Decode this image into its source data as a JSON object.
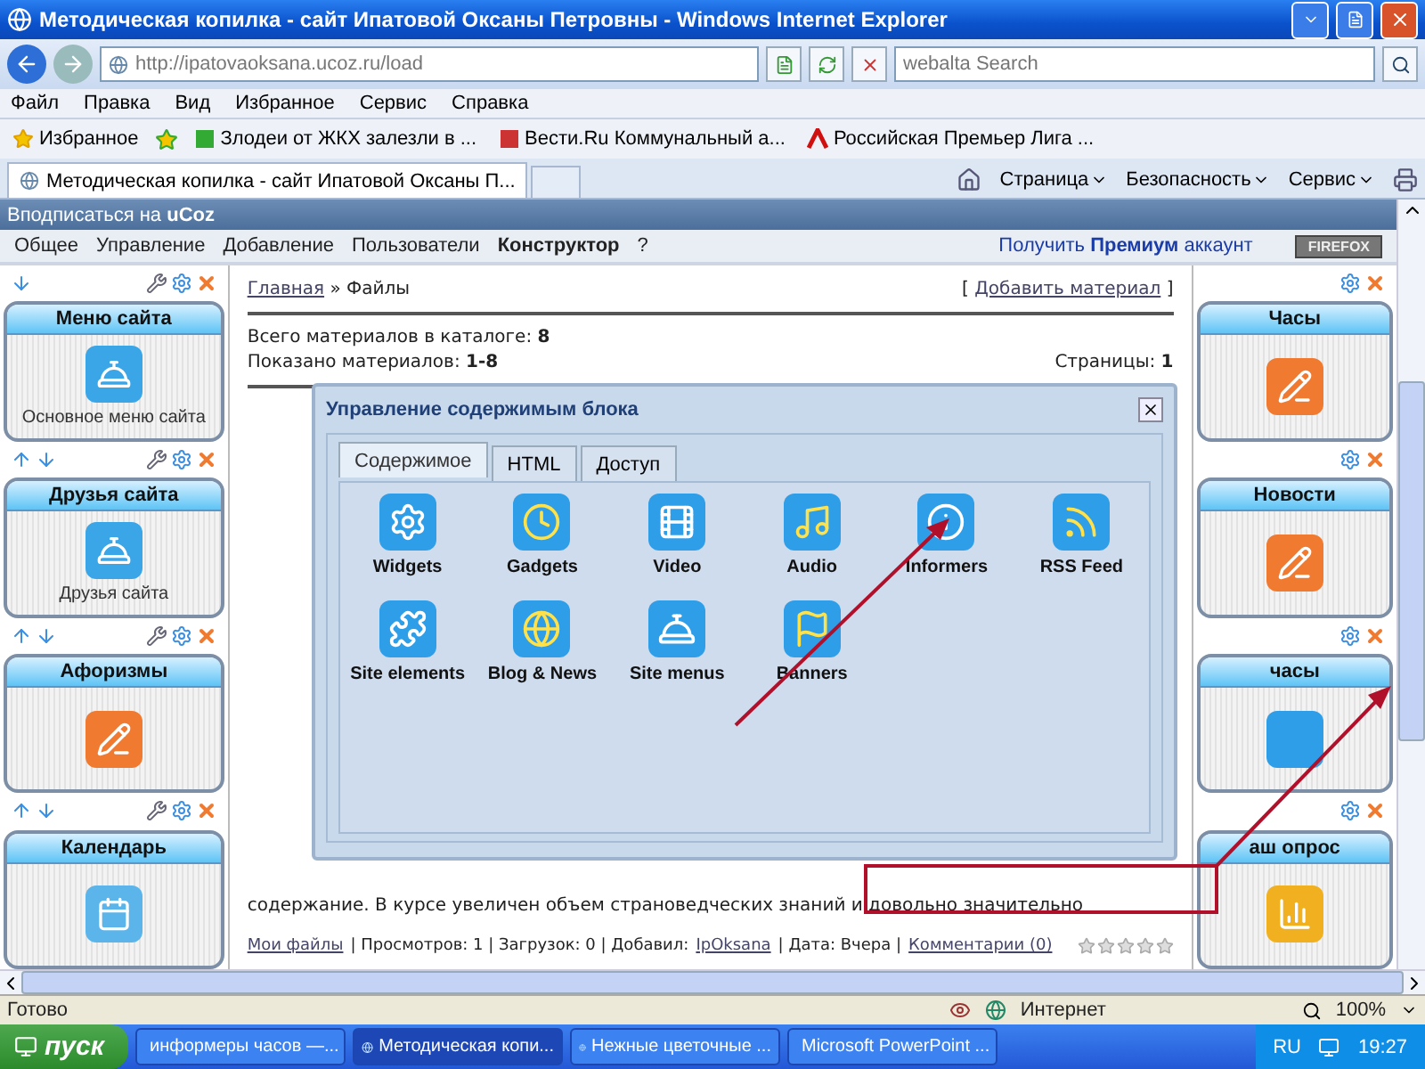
{
  "window": {
    "title": "Методическая копилка - сайт Ипатовой Оксаны Петровны - Windows Internet Explorer"
  },
  "address_bar": {
    "url": "http://ipatovaoksana.ucoz.ru/load"
  },
  "search": {
    "placeholder": "webalta Search"
  },
  "menu": [
    "Файл",
    "Правка",
    "Вид",
    "Избранное",
    "Сервис",
    "Справка"
  ],
  "favorites_bar": {
    "label": "Избранное",
    "links": [
      "Злодеи от ЖКХ залезли в ...",
      "Вести.Ru Коммунальный а...",
      "Российская Премьер Лига ..."
    ]
  },
  "tabs": [
    {
      "label": "Методическая копилка - сайт Ипатовой Оксаны П...",
      "selected": true
    }
  ],
  "command_bar": [
    "Страница",
    "Безопасность",
    "Сервис"
  ],
  "ucoz_bar": {
    "subscribe": "Вподписаться на **uCoz**",
    "premium": "Получить **Премиум** аккаунт",
    "badge": "FIREFOX",
    "menu": [
      {
        "label": "Общее",
        "bold": false
      },
      {
        "label": "Управление",
        "bold": false
      },
      {
        "label": "Добавление",
        "bold": false
      },
      {
        "label": "Пользователи",
        "bold": false
      },
      {
        "label": "Конструктор",
        "bold": true
      },
      {
        "label": "?",
        "bold": false
      }
    ]
  },
  "left_blocks": [
    {
      "title": "Меню сайта",
      "caption": "Основное меню сайта",
      "kind": "dome",
      "can_move_up": false
    },
    {
      "title": "Друзья сайта",
      "caption": "Друзья сайта",
      "kind": "dome",
      "can_move_up": true
    },
    {
      "title": "Афоризмы",
      "kind": "note",
      "can_move_up": true
    },
    {
      "title": "Календарь",
      "kind": "calendar",
      "can_move_up": true
    }
  ],
  "right_blocks": [
    {
      "title": "Часы",
      "kind": "note"
    },
    {
      "title": "Новости",
      "kind": "note"
    },
    {
      "title": "часы",
      "kind": "tile"
    },
    {
      "title": "аш опрос",
      "kind": "chart"
    }
  ],
  "content": {
    "home": "Главная",
    "current": "» Файлы",
    "add_open": "[",
    "add_link": "Добавить материал",
    "add_close": "]",
    "total": "Всего материалов в каталоге: **8**",
    "shown": "Показано материалов: **1-8**",
    "pages": "Страницы: **1**",
    "paragraph": [
      "содержание. В курсе увеличен объем страноведческих знаний и довольно значительно"
    ],
    "footer": [
      {
        "kind": "link",
        "text": "Мои файлы"
      },
      {
        "kind": "text",
        "text": "| Просмотров: 1 | Загрузок: 0 | Добавил:"
      },
      {
        "kind": "link",
        "text": "IpOksana"
      },
      {
        "kind": "text",
        "text": "| Дата: Вчера |"
      },
      {
        "kind": "link",
        "text": "Комментарии (0)"
      }
    ],
    "stars": 0
  },
  "modal": {
    "title": "Управление содержимым блока",
    "tabs": [
      {
        "label": "Содержимое",
        "selected": true
      },
      {
        "label": "HTML",
        "selected": false
      },
      {
        "label": "Доступ",
        "selected": false
      }
    ],
    "items": [
      "Widgets",
      "Gadgets",
      "Video",
      "Audio",
      "Informers",
      "RSS Feed",
      "Site elements",
      "Blog & News",
      "Site menus",
      "Banners"
    ]
  },
  "status_bar": {
    "text": "Готово",
    "zone": "Интернет",
    "zoom": "100%"
  },
  "taskbar": {
    "start": "пуск",
    "tasks": [
      {
        "label": "информеры часов —...",
        "selected": false,
        "kind": "ie"
      },
      {
        "label": "Методическая копи...",
        "selected": true,
        "kind": "ie"
      },
      {
        "label": "Нежные цветочные ...",
        "selected": false,
        "kind": "ie"
      },
      {
        "label": "Microsoft PowerPoint ...",
        "selected": false,
        "kind": "ppt"
      }
    ],
    "lang": "RU",
    "clock": "19:27"
  }
}
